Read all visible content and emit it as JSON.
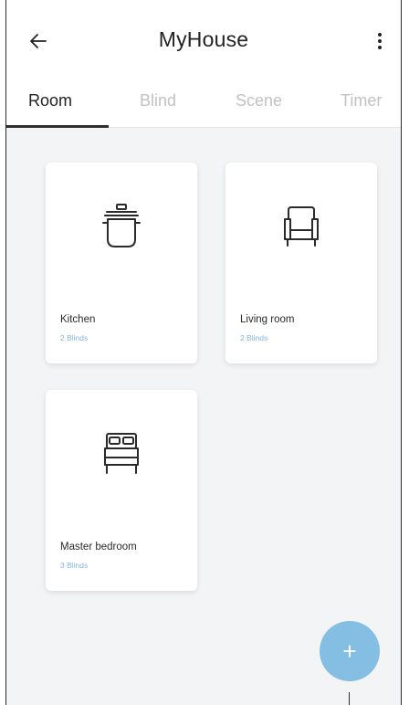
{
  "header": {
    "title": "MyHouse",
    "back_icon": "arrow-left-icon",
    "menu_icon": "more-vertical-icon"
  },
  "tabs": [
    {
      "label": "Room",
      "active": true
    },
    {
      "label": "Blind",
      "active": false
    },
    {
      "label": "Scene",
      "active": false
    },
    {
      "label": "Timer",
      "active": false
    }
  ],
  "rooms": [
    {
      "name": "Kitchen",
      "count": "2 Blinds",
      "icon": "pot-icon"
    },
    {
      "name": "Living room",
      "count": "2 Blinds",
      "icon": "armchair-icon"
    },
    {
      "name": "Master bedroom",
      "count": "3 Blinds",
      "icon": "bed-icon"
    }
  ],
  "fab": {
    "label": "+",
    "icon": "add-icon"
  },
  "colors": {
    "accent": "#84bfe3",
    "count_text": "#82b7db",
    "background": "#f3f4f5",
    "inactive_tab": "#c2c2c2"
  }
}
